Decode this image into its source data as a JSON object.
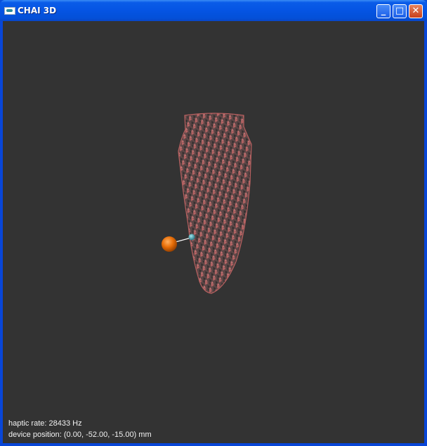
{
  "window": {
    "title": "CHAI 3D",
    "minimize_label": "_",
    "maximize_label": "□",
    "close_label": "✕"
  },
  "scene": {
    "background": "#333333",
    "mesh_color": "#c86a6a",
    "tool_color": "#e8720c",
    "proxy_color": "#3aa8b8"
  },
  "hud": {
    "haptic_rate": "haptic rate: 28433 Hz",
    "device_position": "device position: (0.00, -52.00, -15.00) mm"
  }
}
